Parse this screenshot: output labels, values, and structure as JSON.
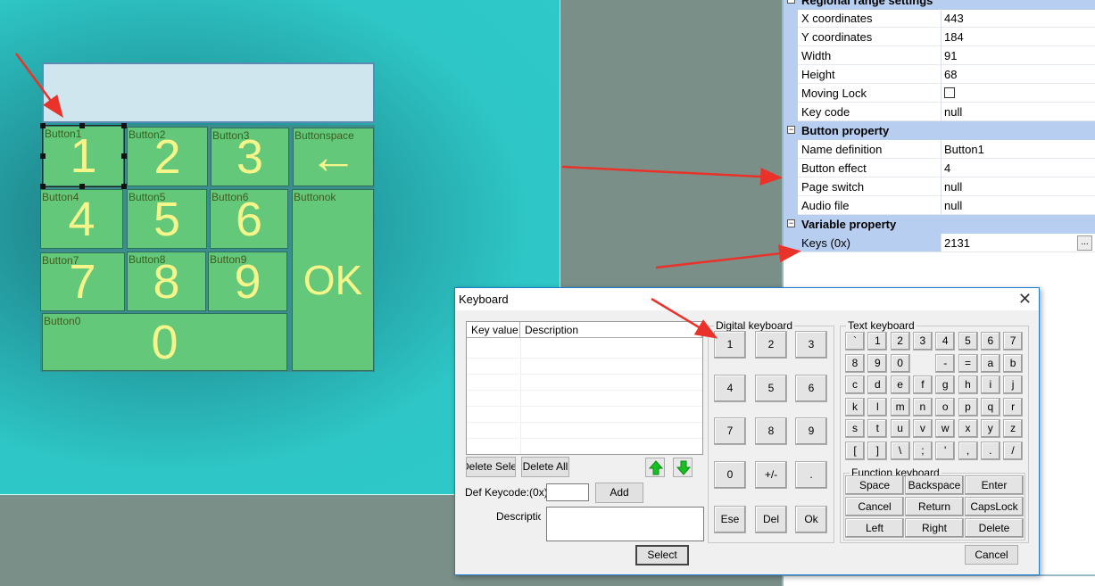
{
  "canvas": {
    "keys": [
      {
        "id": "Button1",
        "label": "Button1",
        "text": "1"
      },
      {
        "id": "Button2",
        "label": "Button2",
        "text": "2"
      },
      {
        "id": "Button3",
        "label": "Button3",
        "text": "3"
      },
      {
        "id": "Buttonspace",
        "label": "Buttonspace",
        "text": "←"
      },
      {
        "id": "Button4",
        "label": "Button4",
        "text": "4"
      },
      {
        "id": "Button5",
        "label": "Button5",
        "text": "5"
      },
      {
        "id": "Button6",
        "label": "Button6",
        "text": "6"
      },
      {
        "id": "Buttonok",
        "label": "Buttonok",
        "text": "OK"
      },
      {
        "id": "Button7",
        "label": "Button7",
        "text": "7"
      },
      {
        "id": "Button8",
        "label": "Button8",
        "text": "8"
      },
      {
        "id": "Button9",
        "label": "Button9",
        "text": "9"
      },
      {
        "id": "Button0",
        "label": "Button0",
        "text": "0"
      }
    ]
  },
  "properties": {
    "regional": {
      "title": "Regional range settings",
      "rows": [
        {
          "name": "X coordinates",
          "value": "443"
        },
        {
          "name": "Y coordinates",
          "value": "184"
        },
        {
          "name": "Width",
          "value": "91"
        },
        {
          "name": "Height",
          "value": "68"
        },
        {
          "name": "Moving Lock",
          "value": ""
        },
        {
          "name": "Key code",
          "value": "null"
        }
      ]
    },
    "button": {
      "title": "Button property",
      "rows": [
        {
          "name": "Name definition",
          "value": "Button1"
        },
        {
          "name": "Button effect",
          "value": "4"
        },
        {
          "name": "Page switch",
          "value": "null"
        },
        {
          "name": "Audio file",
          "value": "null"
        }
      ]
    },
    "variable": {
      "title": "Variable property",
      "rows": [
        {
          "name": "Keys (0x)",
          "value": "2131",
          "button": "..."
        }
      ]
    }
  },
  "dialog": {
    "title": "Keyboard",
    "list": {
      "col_key": "Key value",
      "col_desc": "Description"
    },
    "delete_selected": "Delete Selected",
    "delete_all": "Delete All",
    "def_keycode_label": "Def Keycode:(0x)",
    "def_keycode_value": "",
    "add": "Add",
    "description_label": "Description",
    "description_value": "",
    "select": "Select",
    "cancel": "Cancel",
    "digital": {
      "title": "Digital keyboard",
      "keys": [
        "1",
        "2",
        "3",
        "4",
        "5",
        "6",
        "7",
        "8",
        "9",
        "0",
        "+/-",
        ".",
        "Ese",
        "Del",
        "Ok"
      ]
    },
    "text_kb": {
      "title": "Text keyboard",
      "rows": [
        [
          "`",
          "1",
          "2",
          "3",
          "4",
          "5",
          "6",
          "7"
        ],
        [
          "8",
          "9",
          "0",
          "",
          "-",
          "=",
          "a",
          "b"
        ],
        [
          "c",
          "d",
          "e",
          "f",
          "g",
          "h",
          "i",
          "j"
        ],
        [
          "k",
          "l",
          "m",
          "n",
          "o",
          "p",
          "q",
          "r"
        ],
        [
          "s",
          "t",
          "u",
          "v",
          "w",
          "x",
          "y",
          "z"
        ],
        [
          "[",
          "]",
          "\\",
          ";",
          "'",
          ",",
          ".",
          "/"
        ]
      ]
    },
    "function_kb": {
      "title": "Function keyboard",
      "keys": [
        "Space",
        "Backspace",
        "Enter",
        "Cancel",
        "Return",
        "CapsLock",
        "Left",
        "Right",
        "Delete"
      ]
    }
  },
  "colors": {
    "accent_arrow": "#e8322a",
    "key_fill": "#64c87a",
    "key_text": "#f5f58a",
    "category": "#b8cef0"
  }
}
